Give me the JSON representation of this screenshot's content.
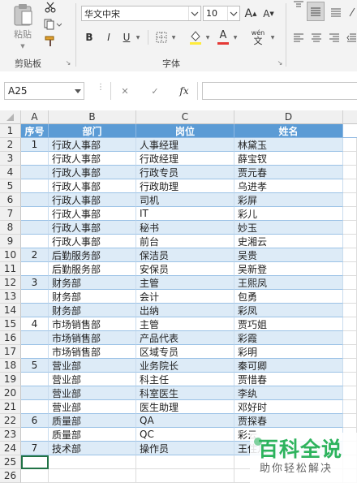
{
  "ribbon": {
    "paste_label": "粘贴",
    "clipboard_group": "剪贴板",
    "font_group": "字体",
    "font_name": "华文中宋",
    "font_size": "10",
    "bold": "B",
    "italic": "I",
    "underline": "U",
    "grow_font": "A",
    "shrink_font": "A",
    "phonetic": "wén",
    "font_color_accent": "#e53935",
    "highlight_accent": "#ffeb3b"
  },
  "formula_bar": {
    "name_box": "A25",
    "cancel_icon": "✕",
    "enter_icon": "✓",
    "fx_label": "fx",
    "content": ""
  },
  "columns": [
    "A",
    "B",
    "C",
    "D"
  ],
  "header": {
    "row": "1",
    "a": "序号",
    "b": "部门",
    "c": "岗位",
    "d": "姓名"
  },
  "rows": [
    {
      "row": "2",
      "a": "1",
      "b": "行政人事部",
      "c": "人事经理",
      "d": "林黛玉"
    },
    {
      "row": "3",
      "a": "",
      "b": "行政人事部",
      "c": "行政经理",
      "d": "薛宝钗"
    },
    {
      "row": "4",
      "a": "",
      "b": "行政人事部",
      "c": "行政专员",
      "d": "贾元春"
    },
    {
      "row": "5",
      "a": "",
      "b": "行政人事部",
      "c": "行政助理",
      "d": "乌进孝"
    },
    {
      "row": "6",
      "a": "",
      "b": "行政人事部",
      "c": "司机",
      "d": "彩屏"
    },
    {
      "row": "7",
      "a": "",
      "b": "行政人事部",
      "c": "IT",
      "d": "彩儿"
    },
    {
      "row": "8",
      "a": "",
      "b": "行政人事部",
      "c": "秘书",
      "d": "妙玉"
    },
    {
      "row": "9",
      "a": "",
      "b": "行政人事部",
      "c": "前台",
      "d": "史湘云"
    },
    {
      "row": "10",
      "a": "2",
      "b": "后勤服务部",
      "c": "保洁员",
      "d": "吴贵"
    },
    {
      "row": "11",
      "a": "",
      "b": "后勤服务部",
      "c": "安保员",
      "d": "吴新登"
    },
    {
      "row": "12",
      "a": "3",
      "b": "财务部",
      "c": "主管",
      "d": "王熙凤"
    },
    {
      "row": "13",
      "a": "",
      "b": "财务部",
      "c": "会计",
      "d": "包勇"
    },
    {
      "row": "14",
      "a": "",
      "b": "财务部",
      "c": "出纳",
      "d": "彩凤"
    },
    {
      "row": "15",
      "a": "4",
      "b": "市场销售部",
      "c": "主管",
      "d": "贾巧姐"
    },
    {
      "row": "16",
      "a": "",
      "b": "市场销售部",
      "c": "产品代表",
      "d": "彩霞"
    },
    {
      "row": "17",
      "a": "",
      "b": "市场销售部",
      "c": "区域专员",
      "d": "彩明"
    },
    {
      "row": "18",
      "a": "5",
      "b": "营业部",
      "c": "业务院长",
      "d": "秦可卿"
    },
    {
      "row": "19",
      "a": "",
      "b": "营业部",
      "c": "科主任",
      "d": "贾惜春"
    },
    {
      "row": "20",
      "a": "",
      "b": "营业部",
      "c": "科室医生",
      "d": "李纨"
    },
    {
      "row": "21",
      "a": "",
      "b": "营业部",
      "c": "医生助理",
      "d": "邓好时"
    },
    {
      "row": "22",
      "a": "6",
      "b": "质量部",
      "c": "QA",
      "d": "贾探春"
    },
    {
      "row": "23",
      "a": "",
      "b": "质量部",
      "c": "QC",
      "d": "彩云"
    },
    {
      "row": "24",
      "a": "7",
      "b": "技术部",
      "c": "操作员",
      "d": "王住儿"
    }
  ],
  "empty_rows": [
    "25",
    "26"
  ],
  "watermark": {
    "title": "百科全说",
    "subtitle": "助你轻松解决"
  }
}
